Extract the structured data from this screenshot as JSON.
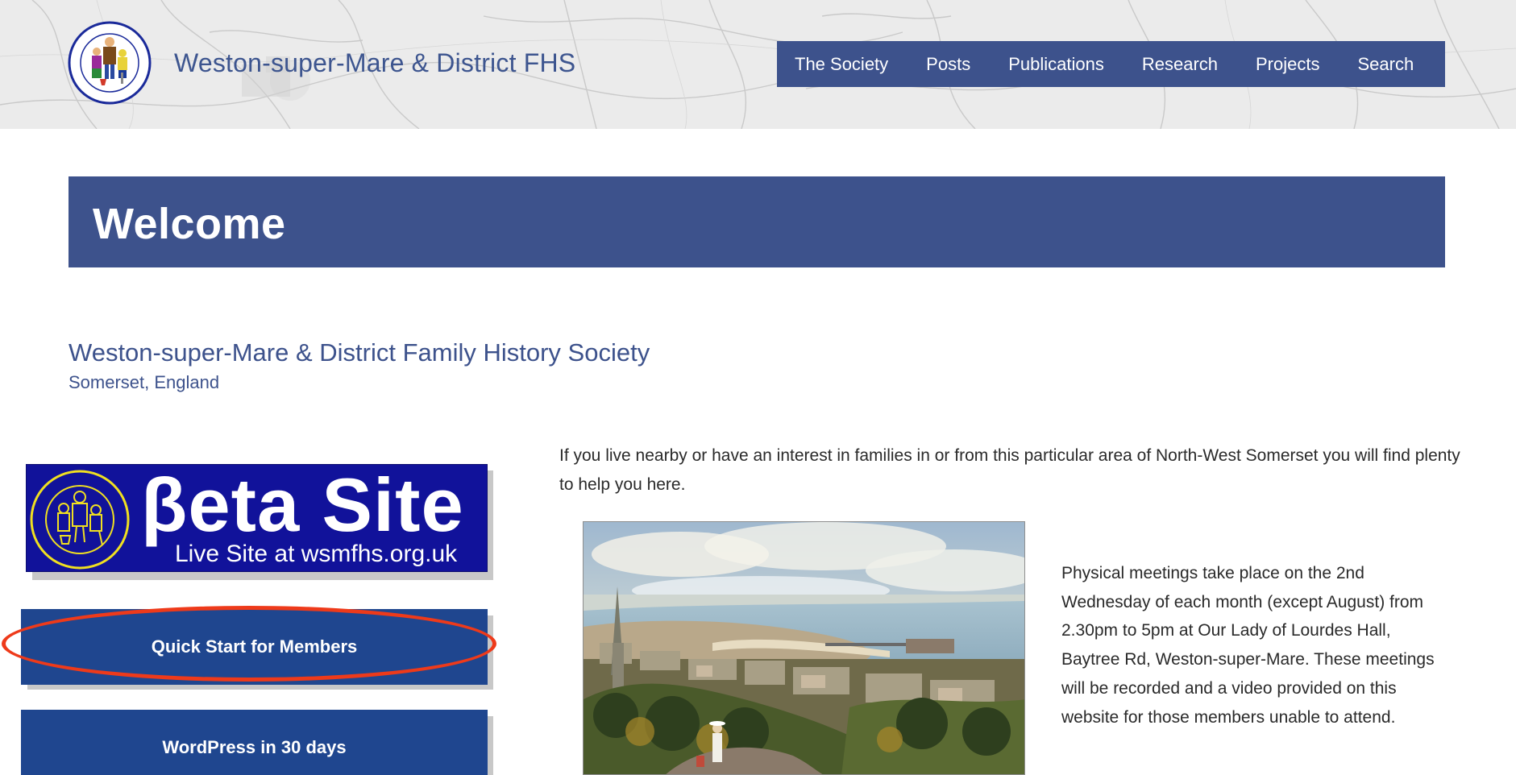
{
  "header": {
    "site_title": "Weston-super-Mare & District FHS",
    "logo_icon": "society-logo-icon",
    "nav_items": [
      {
        "label": "The Society"
      },
      {
        "label": "Posts"
      },
      {
        "label": "Publications"
      },
      {
        "label": "Research"
      },
      {
        "label": "Projects"
      },
      {
        "label": "Search"
      }
    ]
  },
  "welcome": {
    "title": "Welcome"
  },
  "society": {
    "name": "Weston-super-Mare & District Family History Society",
    "location": "Somerset, England"
  },
  "sidebar": {
    "beta_banner": {
      "title": "βeta Site",
      "subtitle": "Live Site at wsmfhs.org.uk"
    },
    "buttons": [
      {
        "label": "Quick Start for Members"
      },
      {
        "label": "WordPress in 30 days"
      }
    ]
  },
  "content": {
    "intro": "If you live nearby or have an interest in families in or from this particular area of North-West Somerset you will find plenty to help you here.",
    "meetings": "Physical meetings take place on the 2nd Wednesday of each month (except August) from 2.30pm to 5pm at Our Lady of Lourdes Hall, Baytree Rd, Weston-super-Mare. These meetings will be recorded and a video provided on this website for those members unable to attend."
  },
  "colors": {
    "primary": "#3d528c",
    "button": "#1f468f",
    "beta_bg": "#11129a",
    "highlight": "#ee3a1a"
  }
}
